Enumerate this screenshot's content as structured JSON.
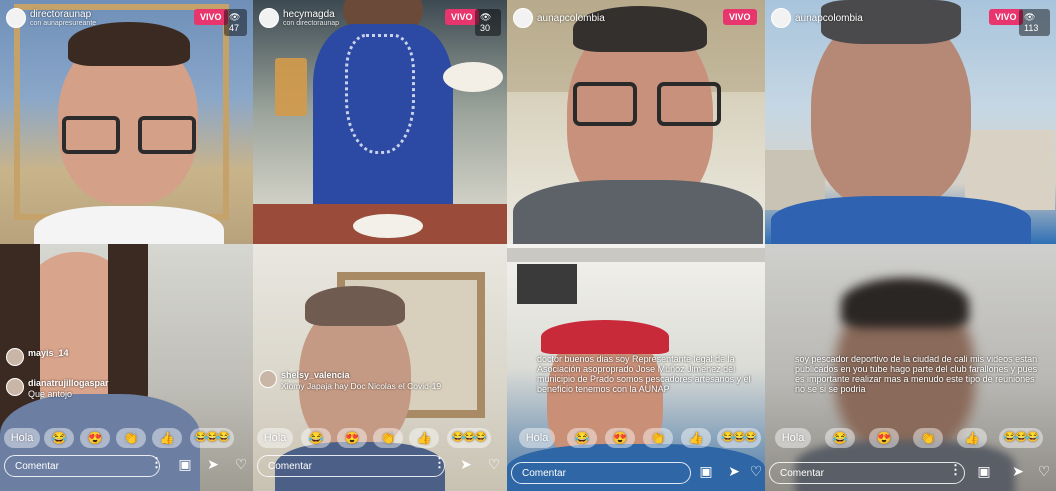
{
  "streams": [
    {
      "username": "directoraunap",
      "subtitle": "con aunapresureante",
      "live_label": "VIVO",
      "viewer_count": "47",
      "comments": [
        {
          "user": "mayis_14",
          "text": ""
        },
        {
          "user": "dianatrujillogaspar",
          "text": "Que antojo"
        }
      ]
    },
    {
      "username": "hecymagda",
      "subtitle": "con directoraunap",
      "live_label": "VIVO",
      "viewer_count": "30",
      "comments": [
        {
          "user": "shelsy_valencia",
          "text": "Xiomy Japaja hay Doc Nicolas el Covid-19"
        }
      ]
    },
    {
      "username": "aunapcolombia",
      "subtitle": "",
      "live_label": "VIVO",
      "viewer_count": "",
      "comments": [
        {
          "user": "",
          "text": "doctor buenos dias soy Representante legal de la Asociación asoproprado Jose Muñoz Jimenez del municipio de Prado somos pescadores artesanos y el beneficio tenemos con la AUNAP"
        }
      ]
    },
    {
      "username": "aunapcolombia",
      "subtitle": "",
      "live_label": "VIVO",
      "viewer_count": "113",
      "comments": [
        {
          "user": "",
          "text": "soy pescador deportivo de la ciudad de cali mis videos estan publicados en you tube hago parte del club farallones y pues es importante realizar mas a menudo este tipo de reuniones no se si se podria"
        }
      ]
    }
  ],
  "reactions": {
    "hola": "Hola",
    "laugh": "😂",
    "heart_eyes": "😍",
    "clap": "👏",
    "thumbs": "👍",
    "triple": "😂😂😂"
  },
  "bottom_bar": {
    "comment_placeholder": "Comentar",
    "more": "⋮",
    "share_icon": "▣",
    "send_icon": "➤",
    "heart_icon": "♡"
  },
  "colors": {
    "live_badge": "#e8356d",
    "overlay_text": "#ffffff"
  }
}
